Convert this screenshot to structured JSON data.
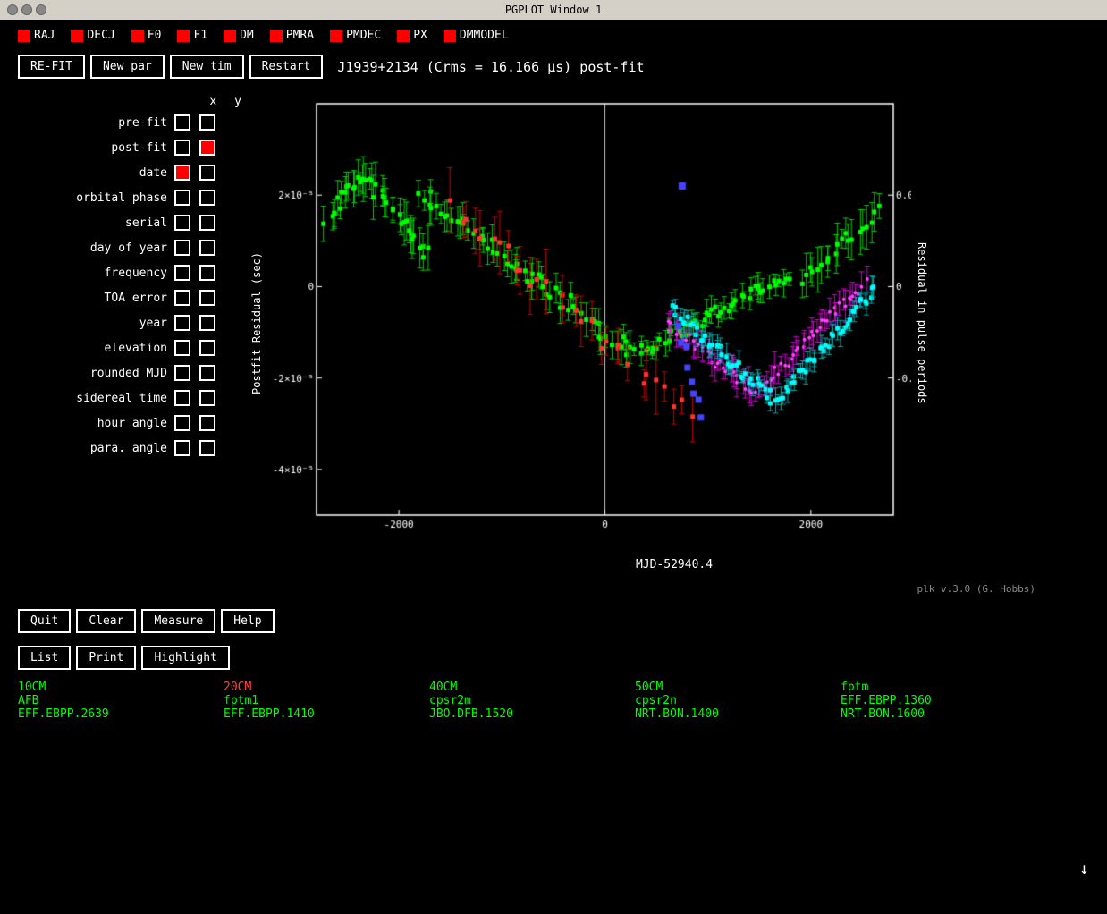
{
  "window": {
    "title": "PGPLOT Window 1"
  },
  "top_params": [
    {
      "label": "RAJ"
    },
    {
      "label": "DECJ"
    },
    {
      "label": "F0"
    },
    {
      "label": "F1"
    },
    {
      "label": "DM"
    },
    {
      "label": "PMRA"
    },
    {
      "label": "PMDEC"
    },
    {
      "label": "PX"
    },
    {
      "label": "DMMODEL"
    }
  ],
  "toolbar": {
    "refit_label": "RE-FIT",
    "newpar_label": "New par",
    "newtim_label": "New tim",
    "restart_label": "Restart",
    "plot_title": "J1939+2134 (Crms = 16.166 μs) post-fit"
  },
  "rows": [
    {
      "label": "pre-fit",
      "x": false,
      "y": false
    },
    {
      "label": "post-fit",
      "x": false,
      "y": true,
      "y_red": true
    },
    {
      "label": "date",
      "x": true,
      "x_red": true,
      "y": false
    },
    {
      "label": "orbital phase",
      "x": false,
      "y": false
    },
    {
      "label": "serial",
      "x": false,
      "y": false
    },
    {
      "label": "day of year",
      "x": false,
      "y": false
    },
    {
      "label": "frequency",
      "x": false,
      "y": false
    },
    {
      "label": "TOA error",
      "x": false,
      "y": false
    },
    {
      "label": "year",
      "x": false,
      "y": false
    },
    {
      "label": "elevation",
      "x": false,
      "y": false
    },
    {
      "label": "rounded MJD",
      "x": false,
      "y": false
    },
    {
      "label": "sidereal time",
      "x": false,
      "y": false
    },
    {
      "label": "hour angle",
      "x": false,
      "y": false
    },
    {
      "label": "para. angle",
      "x": false,
      "y": false
    }
  ],
  "bottom_buttons": {
    "quit_label": "Quit",
    "clear_label": "Clear",
    "measure_label": "Measure",
    "help_label": "Help",
    "list_label": "List",
    "print_label": "Print",
    "highlight_label": "Highlight"
  },
  "x_axis_label": "MJD-52940.4",
  "y_axis_left": "Postfit Residual (sec)",
  "y_axis_right": "Residual in pulse periods",
  "plk_version": "plk v.3.0 (G. Hobbs)",
  "legend": {
    "col1": [
      "10CM",
      "AFB",
      "EFF.EBPP.2639"
    ],
    "col2": [
      "20CM",
      "fptm1",
      "EFF.EBPP.1410"
    ],
    "col3": [
      "40CM",
      "cpsr2m",
      "JBO.DFB.1520"
    ],
    "col4": [
      "50CM",
      "cpsr2n",
      "NRT.BON.1400"
    ],
    "col5": [
      "fptm",
      "EFF.EBPP.1360",
      "NRT.BON.1600"
    ]
  },
  "legend_colors": {
    "col1": [
      "green",
      "green",
      "green"
    ],
    "col2": [
      "red",
      "green",
      "green"
    ],
    "col3": [
      "green",
      "green",
      "green"
    ],
    "col4": [
      "green",
      "green",
      "green"
    ],
    "col5": [
      "green",
      "green",
      "green"
    ]
  }
}
